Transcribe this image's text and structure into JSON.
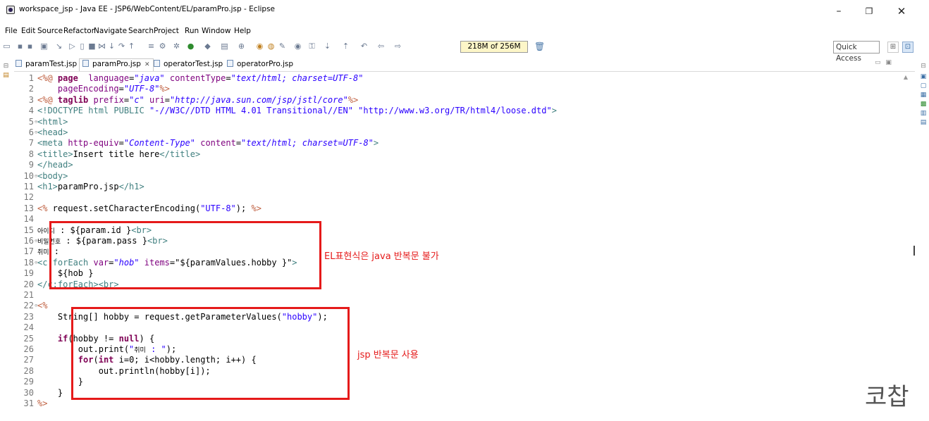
{
  "window": {
    "title": "workspace_jsp - Java EE - JSP6/WebContent/EL/paramPro.jsp - Eclipse",
    "controls": [
      "–",
      "❐",
      "✕"
    ]
  },
  "menubar": [
    "File",
    "Edit",
    "Source",
    "Refactor",
    "Navigate",
    "Search",
    "Project",
    "Run",
    "Window",
    "Help"
  ],
  "toolbar": {
    "heap_status": "218M of 256M",
    "quick_access": "Quick Access"
  },
  "tabs": [
    {
      "label": "paramTest.jsp",
      "active": false
    },
    {
      "label": "paramPro.jsp",
      "active": true,
      "close": "✕"
    },
    {
      "label": "operatorTest.jsp",
      "active": false
    },
    {
      "label": "operatorPro.jsp",
      "active": false
    }
  ],
  "code_lines": [
    {
      "n": "1",
      "fold": "",
      "segs": [
        [
          "dir",
          "<%@ "
        ],
        [
          "kw",
          "page"
        ],
        [
          "",
          "  "
        ],
        [
          "attr",
          "language"
        ],
        [
          "",
          "="
        ],
        [
          "val",
          "\"java\""
        ],
        [
          "",
          " "
        ],
        [
          "attr",
          "contentType"
        ],
        [
          "",
          "="
        ],
        [
          "val",
          "\"text/html; charset=UTF-8\""
        ]
      ]
    },
    {
      "n": "2",
      "fold": "",
      "segs": [
        [
          "",
          "    "
        ],
        [
          "attr",
          "pageEncoding"
        ],
        [
          "",
          "="
        ],
        [
          "val",
          "\"UTF-8\""
        ],
        [
          "dir",
          "%>"
        ]
      ]
    },
    {
      "n": "3",
      "fold": "",
      "segs": [
        [
          "dir",
          "<%@ "
        ],
        [
          "kw",
          "taglib"
        ],
        [
          "",
          " "
        ],
        [
          "attr",
          "prefix"
        ],
        [
          "",
          "="
        ],
        [
          "val",
          "\"c\""
        ],
        [
          "",
          " "
        ],
        [
          "attr",
          "uri"
        ],
        [
          "",
          "="
        ],
        [
          "val",
          "\"http://java.sun.com/jsp/jstl/core\""
        ],
        [
          "dir",
          "%>"
        ]
      ]
    },
    {
      "n": "4",
      "fold": "",
      "segs": [
        [
          "tag",
          "<!DOCTYPE html PUBLIC "
        ],
        [
          "str",
          "\"-//W3C//DTD HTML 4.01 Transitional//EN\""
        ],
        [
          "",
          " "
        ],
        [
          "str",
          "\"http://www.w3.org/TR/html4/loose.dtd\""
        ],
        [
          "tag",
          ">"
        ]
      ]
    },
    {
      "n": "5",
      "fold": "⊖",
      "segs": [
        [
          "tag",
          "<html>"
        ]
      ]
    },
    {
      "n": "6",
      "fold": "⊖",
      "segs": [
        [
          "tag",
          "<head>"
        ]
      ]
    },
    {
      "n": "7",
      "fold": "",
      "segs": [
        [
          "tag",
          "<meta "
        ],
        [
          "attr",
          "http-equiv"
        ],
        [
          "",
          "="
        ],
        [
          "val",
          "\"Content-Type\""
        ],
        [
          "",
          " "
        ],
        [
          "attr",
          "content"
        ],
        [
          "",
          "="
        ],
        [
          "val",
          "\"text/html; charset=UTF-8\""
        ],
        [
          "tag",
          ">"
        ]
      ]
    },
    {
      "n": "8",
      "fold": "",
      "segs": [
        [
          "tag",
          "<title>"
        ],
        [
          "",
          "Insert title here"
        ],
        [
          "tag",
          "</title>"
        ]
      ]
    },
    {
      "n": "9",
      "fold": "",
      "segs": [
        [
          "tag",
          "</head>"
        ]
      ]
    },
    {
      "n": "10",
      "fold": "⊖",
      "segs": [
        [
          "tag",
          "<body>"
        ]
      ]
    },
    {
      "n": "11",
      "fold": "",
      "segs": [
        [
          "tag",
          "<h1>"
        ],
        [
          "",
          "paramPro.jsp"
        ],
        [
          "tag",
          "</h1>"
        ]
      ]
    },
    {
      "n": "12",
      "fold": "",
      "segs": []
    },
    {
      "n": "13",
      "fold": "",
      "segs": [
        [
          "dir",
          "<%"
        ],
        [
          "",
          " request.setCharacterEncoding("
        ],
        [
          "str",
          "\"UTF-8\""
        ],
        [
          "",
          "); "
        ],
        [
          "dir",
          "%>"
        ]
      ]
    },
    {
      "n": "14",
      "fold": "",
      "segs": []
    },
    {
      "n": "15",
      "fold": "",
      "segs": [
        [
          "kor",
          "아이디"
        ],
        [
          "",
          " : ${param.id }"
        ],
        [
          "tag",
          "<br>"
        ]
      ]
    },
    {
      "n": "16",
      "fold": "⊖",
      "segs": [
        [
          "kor",
          "비밀번호"
        ],
        [
          "",
          " : ${param.pass }"
        ],
        [
          "tag",
          "<br>"
        ]
      ]
    },
    {
      "n": "17",
      "fold": "",
      "segs": [
        [
          "kor",
          "취미"
        ],
        [
          "",
          " :"
        ]
      ]
    },
    {
      "n": "18",
      "fold": "⊖",
      "segs": [
        [
          "tag",
          "<c:forEach "
        ],
        [
          "attr",
          "var"
        ],
        [
          "",
          "="
        ],
        [
          "val",
          "\"hob\""
        ],
        [
          "",
          " "
        ],
        [
          "attr",
          "items"
        ],
        [
          "",
          "="
        ],
        [
          "",
          "\"${paramValues.hobby }\""
        ],
        [
          "tag",
          ">"
        ]
      ]
    },
    {
      "n": "19",
      "fold": "",
      "segs": [
        [
          "",
          "    ${hob }"
        ]
      ]
    },
    {
      "n": "20",
      "fold": "",
      "segs": [
        [
          "tag",
          "</c:forEach><br>"
        ]
      ]
    },
    {
      "n": "21",
      "fold": "",
      "segs": []
    },
    {
      "n": "22",
      "fold": "⊖",
      "segs": [
        [
          "dir",
          "<%"
        ]
      ]
    },
    {
      "n": "23",
      "fold": "",
      "segs": [
        [
          "",
          "    String[] hobby = request.getParameterValues("
        ],
        [
          "str",
          "\"hobby\""
        ],
        [
          "",
          ");"
        ]
      ]
    },
    {
      "n": "24",
      "fold": "",
      "segs": []
    },
    {
      "n": "25",
      "fold": "",
      "segs": [
        [
          "",
          "    "
        ],
        [
          "kw",
          "if"
        ],
        [
          "",
          "(hobby != "
        ],
        [
          "kw",
          "null"
        ],
        [
          "",
          ") {"
        ]
      ]
    },
    {
      "n": "26",
      "fold": "",
      "segs": [
        [
          "",
          "        out.print("
        ],
        [
          "str",
          "\""
        ],
        [
          "kor",
          "취미"
        ],
        [
          "str",
          " : \""
        ],
        [
          "",
          ");"
        ]
      ]
    },
    {
      "n": "27",
      "fold": "",
      "segs": [
        [
          "",
          "        "
        ],
        [
          "kw",
          "for"
        ],
        [
          "",
          "("
        ],
        [
          "kw",
          "int"
        ],
        [
          "",
          " i=0; i<hobby.length; i++) {"
        ]
      ]
    },
    {
      "n": "28",
      "fold": "",
      "segs": [
        [
          "",
          "            out.println(hobby[i]);"
        ]
      ]
    },
    {
      "n": "29",
      "fold": "",
      "segs": [
        [
          "",
          "        }"
        ]
      ]
    },
    {
      "n": "30",
      "fold": "",
      "segs": [
        [
          "",
          "    }"
        ]
      ]
    },
    {
      "n": "31",
      "fold": "",
      "segs": [
        [
          "dir",
          "%>"
        ]
      ]
    }
  ],
  "annotations": {
    "note_el": "EL표현식은 java 반복문 불가",
    "note_jsp": "jsp 반복문 사용"
  },
  "watermark": "코찹"
}
